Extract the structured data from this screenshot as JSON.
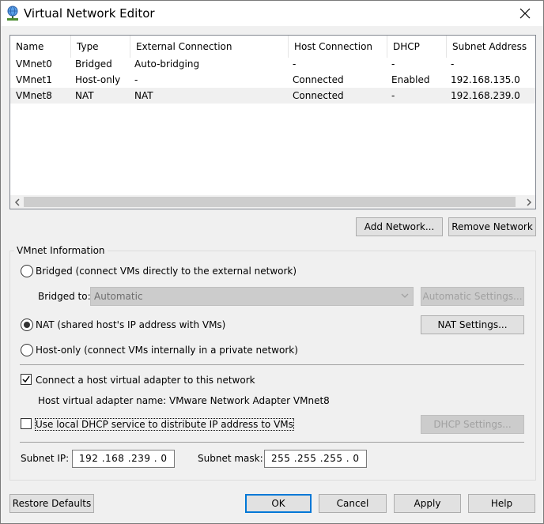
{
  "window": {
    "title": "Virtual Network Editor"
  },
  "icons": {
    "app": "network-globe-icon",
    "close": "close-icon"
  },
  "list": {
    "columns": [
      "Name",
      "Type",
      "External Connection",
      "Host Connection",
      "DHCP",
      "Subnet Address"
    ],
    "rows": [
      [
        "VMnet0",
        "Bridged",
        "Auto-bridging",
        "-",
        "-",
        "-"
      ],
      [
        "VMnet1",
        "Host-only",
        "-",
        "Connected",
        "Enabled",
        "192.168.135.0"
      ],
      [
        "VMnet8",
        "NAT",
        "NAT",
        "Connected",
        "-",
        "192.168.239.0"
      ]
    ],
    "selected_row": 2
  },
  "buttons": {
    "add_network": "Add Network...",
    "remove_network": "Remove Network",
    "automatic_settings": "Automatic Settings...",
    "nat_settings": "NAT Settings...",
    "dhcp_settings": "DHCP Settings...",
    "restore_defaults": "Restore Defaults",
    "ok": "OK",
    "cancel": "Cancel",
    "apply": "Apply",
    "help": "Help"
  },
  "vmnet_info": {
    "title": "VMnet Information",
    "bridged_label": "Bridged (connect VMs directly to the external network)",
    "bridged_to_label": "Bridged to:",
    "bridged_to_value": "Automatic",
    "nat_label": "NAT (shared host's IP address with VMs)",
    "host_only_label": "Host-only (connect VMs internally in a private network)",
    "selected_mode": "nat",
    "connect_adapter_label": "Connect a host virtual adapter to this network",
    "connect_adapter_checked": true,
    "adapter_name_label": "Host virtual adapter name: VMware Network Adapter VMnet8",
    "dhcp_label": "Use local DHCP service to distribute IP address to VMs",
    "dhcp_checked": false,
    "subnet_ip_label": "Subnet IP:",
    "subnet_ip_value": "192 .168 .239 .  0",
    "subnet_mask_label": "Subnet mask:",
    "subnet_mask_value": "255 .255 .255 .  0"
  },
  "colors": {
    "accent": "#0078d7",
    "selected_row": "#f0f0f0",
    "disabled": "#cccccc"
  }
}
